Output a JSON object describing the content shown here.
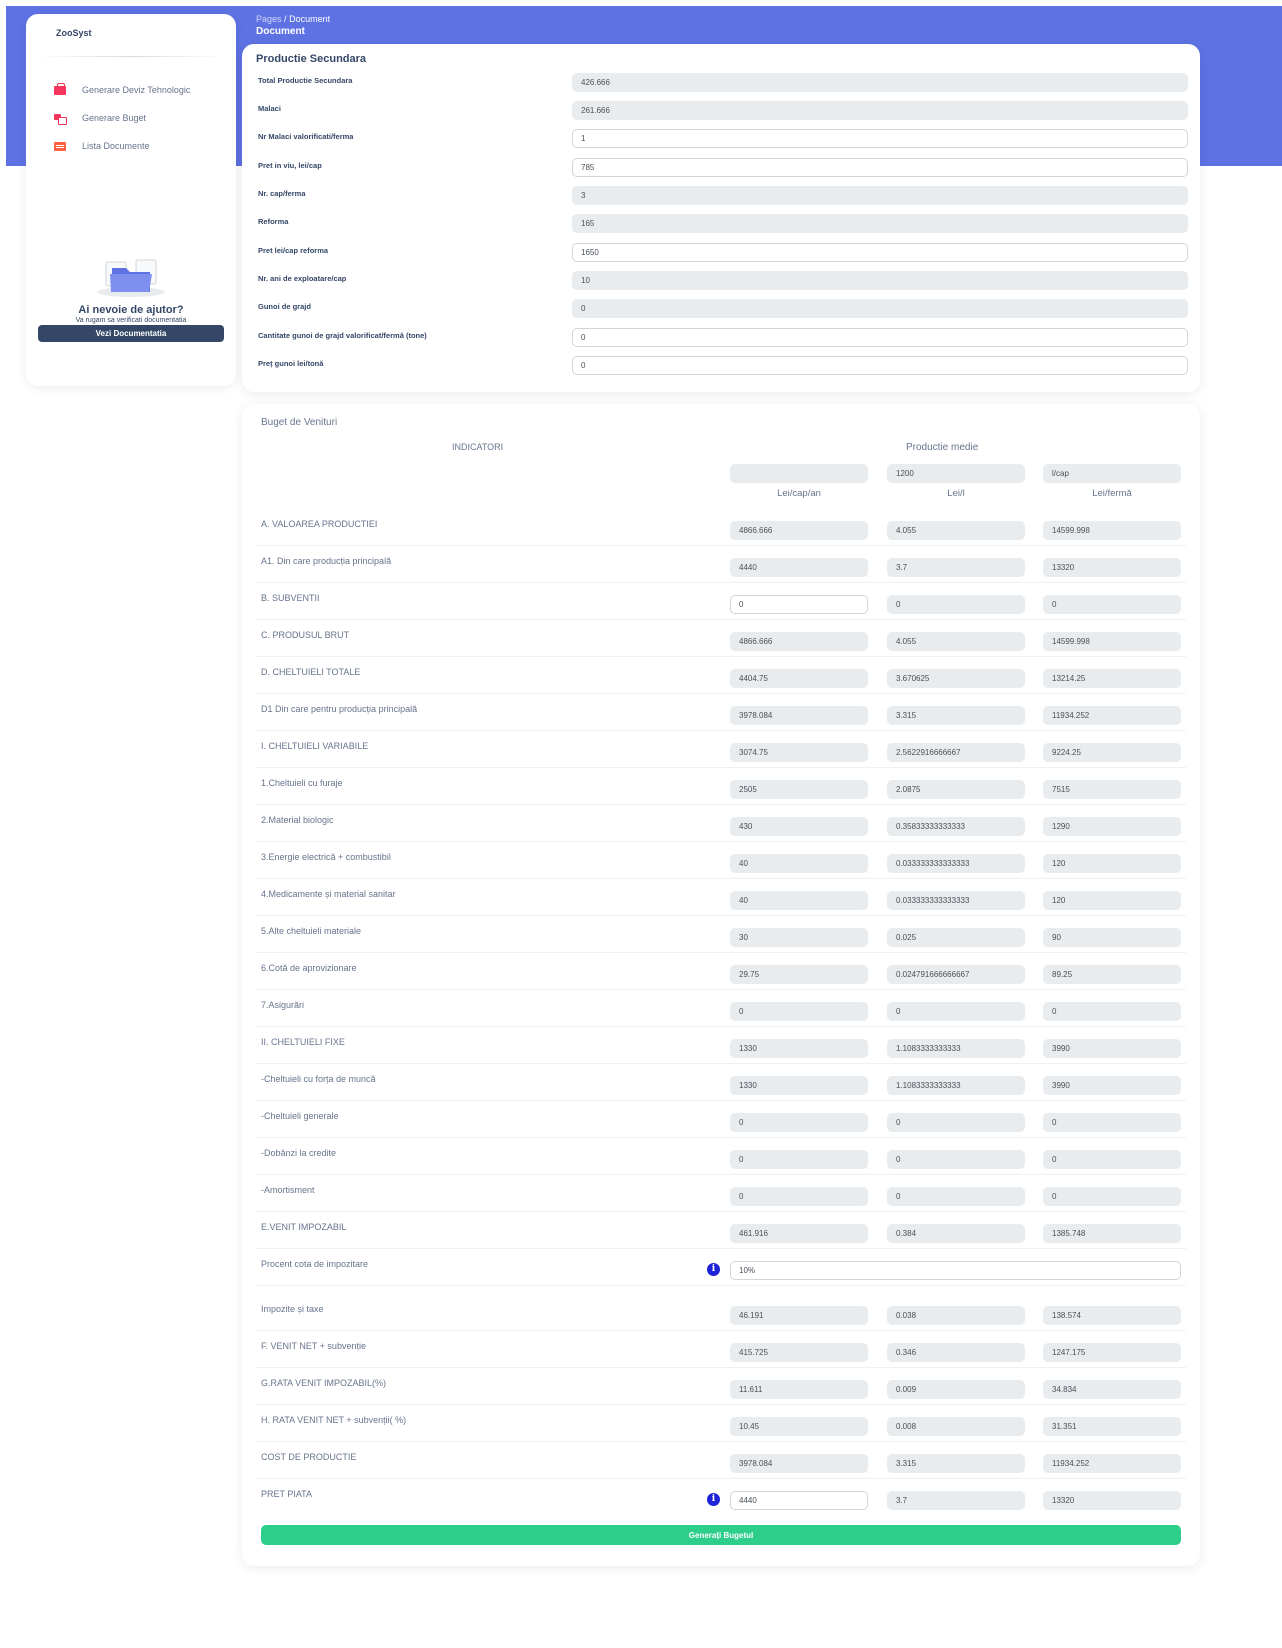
{
  "brand": "ZooSyst",
  "nav": [
    {
      "label": "Generare Deviz Tehnologic",
      "icon": "cart-icon"
    },
    {
      "label": "Generare Buget",
      "icon": "copy-icon"
    },
    {
      "label": "Lista Documente",
      "icon": "list-icon"
    }
  ],
  "help": {
    "title": "Ai nevoie de ajutor?",
    "subtitle": "Va rugam sa verificati documentatia",
    "button": "Vezi Documentatia"
  },
  "breadcrumb": {
    "root": "Pages",
    "sep": "/",
    "current": "Document",
    "title": "Document"
  },
  "productie": {
    "title": "Productie Secundara",
    "fields": [
      {
        "label": "Total Productie Secundara",
        "value": "426.666",
        "readonly": true
      },
      {
        "label": "Malaci",
        "value": "261.666",
        "readonly": true
      },
      {
        "label": "Nr Malaci valorificati/ferma",
        "value": "1",
        "readonly": false
      },
      {
        "label": "Pret in viu, lei/cap",
        "value": "785",
        "readonly": false
      },
      {
        "label": "Nr. cap/ferma",
        "value": "3",
        "readonly": true
      },
      {
        "label": "Reforma",
        "value": "165",
        "readonly": true
      },
      {
        "label": "Pret lei/cap reforma",
        "value": "1650",
        "readonly": false
      },
      {
        "label": "Nr. ani de exploatare/cap",
        "value": "10",
        "readonly": true
      },
      {
        "label": "Gunoi de grajd",
        "value": "0",
        "readonly": true
      },
      {
        "label": "Cantitate gunoi de grajd valorificat/fermă (tone)",
        "value": "0",
        "readonly": false
      },
      {
        "label": "Preț gunoi lei/tonă",
        "value": "0",
        "readonly": false
      }
    ]
  },
  "buget": {
    "title": "Buget de Venituri",
    "header_indicatori": "INDICATORI",
    "header_productie": "Productie medie",
    "header_inputs": [
      "",
      "1200",
      "l/cap"
    ],
    "units": [
      "Lei/cap/an",
      "Lei/l",
      "Lei/fermă"
    ],
    "rows": [
      {
        "label": "A. VALOAREA PRODUCTIEI",
        "values": [
          "4866.666",
          "4.055",
          "14599.998"
        ]
      },
      {
        "label": "A1. Din care producția principală",
        "values": [
          "4440",
          "3.7",
          "13320"
        ]
      },
      {
        "label": "B. SUBVENTII",
        "values": [
          "0",
          "0",
          "0"
        ],
        "editable": true
      },
      {
        "label": "C. PRODUSUL BRUT",
        "values": [
          "4866.666",
          "4.055",
          "14599.998"
        ]
      },
      {
        "label": "D. CHELTUIELI TOTALE",
        "values": [
          "4404.75",
          "3.670625",
          "13214.25"
        ]
      },
      {
        "label": "D1 Din care pentru producția principală",
        "values": [
          "3978.084",
          "3.315",
          "11934.252"
        ]
      },
      {
        "label": "I. CHELTUIELI VARIABILE",
        "values": [
          "3074.75",
          "2.5622916666667",
          "9224.25"
        ]
      },
      {
        "label": "1.Cheltuieli cu furaje",
        "values": [
          "2505",
          "2.0875",
          "7515"
        ]
      },
      {
        "label": "2.Material biologic",
        "values": [
          "430",
          "0.35833333333333",
          "1290"
        ]
      },
      {
        "label": "3.Energie electrică + combustibil",
        "values": [
          "40",
          "0.033333333333333",
          "120"
        ]
      },
      {
        "label": "4.Medicamente și material sanitar",
        "values": [
          "40",
          "0.033333333333333",
          "120"
        ]
      },
      {
        "label": "5.Alte cheltuieli materiale",
        "values": [
          "30",
          "0.025",
          "90"
        ]
      },
      {
        "label": "6.Cotă de aprovizionare",
        "values": [
          "29.75",
          "0.024791666666667",
          "89.25"
        ]
      },
      {
        "label": "7.Asigurări",
        "values": [
          "0",
          "0",
          "0"
        ]
      },
      {
        "label": "II. CHELTUIELI FIXE",
        "values": [
          "1330",
          "1.1083333333333",
          "3990"
        ]
      },
      {
        "label": "-Cheltuieli cu forța de muncă",
        "values": [
          "1330",
          "1.1083333333333",
          "3990"
        ]
      },
      {
        "label": "-Cheltuieli generale",
        "values": [
          "0",
          "0",
          "0"
        ]
      },
      {
        "label": "-Dobânzi la credite",
        "values": [
          "0",
          "0",
          "0"
        ]
      },
      {
        "label": "-Amortisment",
        "values": [
          "0",
          "0",
          "0"
        ]
      },
      {
        "label": "E.VENIT IMPOZABIL",
        "values": [
          "461.916",
          "0.384",
          "1385.748"
        ]
      }
    ],
    "procent": {
      "label": "Procent cota de impozitare",
      "value": "10%"
    },
    "rows2": [
      {
        "label": "Impozite și taxe",
        "values": [
          "46.191",
          "0.038",
          "138.574"
        ]
      },
      {
        "label": "F. VENIT NET + subvenție",
        "values": [
          "415.725",
          "0.346",
          "1247.175"
        ]
      },
      {
        "label": "G.RATA VENIT IMPOZABIL(%)",
        "values": [
          "11.611",
          "0.009",
          "34.834"
        ]
      },
      {
        "label": "H. RATA VENIT NET + subvenții( %)",
        "values": [
          "10.45",
          "0.008",
          "31.351"
        ]
      },
      {
        "label": "COST DE PRODUCTIE",
        "values": [
          "3978.084",
          "3.315",
          "11934.252"
        ]
      }
    ],
    "pret_piata": {
      "label": "PRET PIATA",
      "values": [
        "4440",
        "3.7",
        "13320"
      ]
    },
    "button": "Generați Bugetul"
  }
}
